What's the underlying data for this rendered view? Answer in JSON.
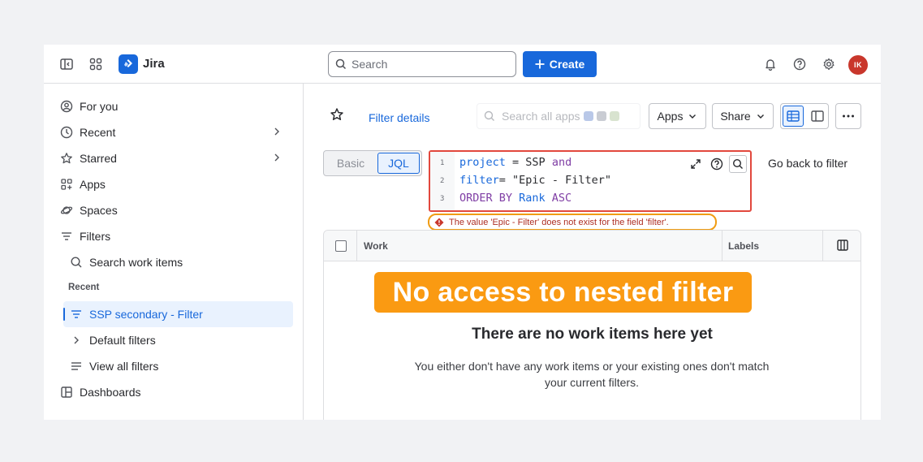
{
  "topbar": {
    "app_name": "Jira",
    "search_placeholder": "Search",
    "create_label": "Create",
    "avatar_initials": "IK",
    "icons": [
      "sidebar-toggle-icon",
      "app-switcher-icon",
      "jira-logo",
      "search-icon",
      "plus-icon",
      "bell-icon",
      "help-icon",
      "gear-icon"
    ]
  },
  "sidebar": {
    "items": [
      {
        "label": "For you",
        "icon": "user-circle-icon"
      },
      {
        "label": "Recent",
        "icon": "clock-icon"
      },
      {
        "label": "Starred",
        "icon": "star-icon"
      },
      {
        "label": "Apps",
        "icon": "apps-icon"
      },
      {
        "label": "Spaces",
        "icon": "planet-icon"
      },
      {
        "label": "Filters",
        "icon": "filter-icon"
      }
    ],
    "filters_sub": {
      "search_work_items": "Search work items",
      "recent_heading": "Recent",
      "active_filter": "SSP secondary - Filter",
      "default_filters": "Default filters",
      "view_all": "View all filters"
    },
    "dashboards": "Dashboards"
  },
  "header": {
    "filter_details": "Filter details",
    "apps_search_placeholder": "Search all apps",
    "apps_button": "Apps",
    "share_button": "Share"
  },
  "query": {
    "mode_basic": "Basic",
    "mode_jql": "JQL",
    "line_numbers": [
      "1",
      "2",
      "3"
    ],
    "line1": {
      "field": "project",
      "op": " = ",
      "value": "SSP ",
      "kw": "and"
    },
    "line2": {
      "field": "filter",
      "op": "= ",
      "value": "\"Epic - Filter\""
    },
    "line3": {
      "kw": "ORDER BY ",
      "field": "Rank ",
      "dir": "ASC"
    },
    "go_back": "Go back to filter",
    "error": "The value 'Epic - Filter' does not exist for the field 'filter'."
  },
  "table": {
    "col_work": "Work",
    "col_labels": "Labels"
  },
  "annotation": "No access to nested filter",
  "empty_state": {
    "title": "There are no work items here yet",
    "description": "You either don't have any work items or your existing ones don't match your current filters."
  },
  "colors": {
    "brand": "#1868db",
    "error_border": "#e2483d",
    "annotation": "#fa9a12",
    "avatar": "#c9372c"
  }
}
